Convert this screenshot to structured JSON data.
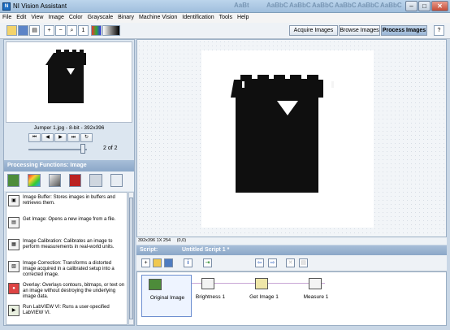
{
  "window": {
    "title": "NI Vision Assistant",
    "background_tabs": [
      "AaBt",
      "AaBbC",
      "AaBbC",
      "AaBbC",
      "AaBbC",
      "AaBbC",
      "AaBbC",
      "AaBbC"
    ]
  },
  "menu": [
    "File",
    "Edit",
    "View",
    "Image",
    "Color",
    "Grayscale",
    "Binary",
    "Machine Vision",
    "Identification",
    "Tools",
    "Help"
  ],
  "modes": {
    "acquire": "Acquire Images",
    "browse": "Browse Images",
    "process": "Process Images"
  },
  "browser": {
    "caption": "Jumper 1.jpg - 8-bit - 392x396",
    "page_current": "2",
    "page_of": "of",
    "page_total": "2"
  },
  "processing": {
    "header": "Processing Functions: Image",
    "functions": [
      {
        "icon": "image-buffer-icon",
        "name": "Image Buffer:",
        "desc": "Stores images in buffers and retrieves them."
      },
      {
        "icon": "get-image-icon",
        "name": "Get Image:",
        "desc": "Opens a new image from a file."
      },
      {
        "icon": "image-calibration-icon",
        "name": "Image Calibration:",
        "desc": "Calibrates an image to perform measurements in real-world units."
      },
      {
        "icon": "image-correction-icon",
        "name": "Image Correction:",
        "desc": "Transforms a distorted image acquired in a calibrated setup into a corrected image."
      },
      {
        "icon": "overlay-icon",
        "name": "Overlay:",
        "desc": "Overlays contours, bitmaps, or text on an image without destroying the underlying image data."
      },
      {
        "icon": "run-labview-icon",
        "name": "Run LabVIEW VI:",
        "desc": "Runs a user-specified LabVIEW VI."
      }
    ]
  },
  "status": {
    "dims": "392x396 1X 254",
    "coords": "(0,0)"
  },
  "script": {
    "label": "Script:",
    "title": "Untitled Script 1 *",
    "steps": [
      "Original Image",
      "Brightness 1",
      "Get Image 1",
      "Measure 1"
    ]
  }
}
